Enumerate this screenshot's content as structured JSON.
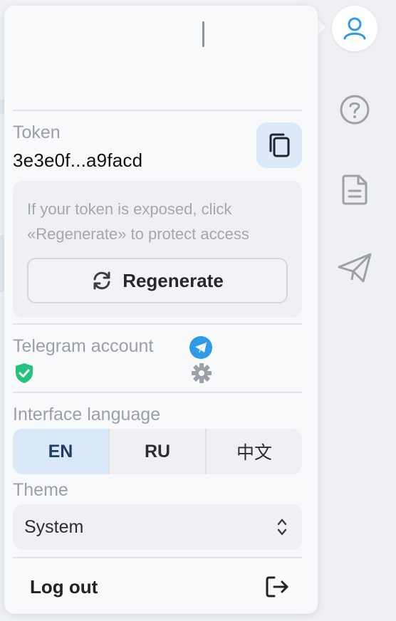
{
  "token": {
    "label": "Token",
    "value": "3e3e0f...a9facd",
    "warning": "If your token is exposed, click «Regenerate» to protect access",
    "regenerate_label": "Regenerate"
  },
  "telegram": {
    "label": "Telegram account"
  },
  "language": {
    "label": "Interface language",
    "options": [
      "EN",
      "RU",
      "中文"
    ],
    "selected": "EN"
  },
  "theme": {
    "label": "Theme",
    "value": "System"
  },
  "logout": {
    "label": "Log out"
  },
  "colors": {
    "accent": "#2f9ae8",
    "active_lang_bg": "#dbe8f8",
    "shield_green": "#22c37a",
    "rail_icon": "#9ca1a8"
  },
  "rail_icons": [
    "user-icon",
    "help-icon",
    "document-icon",
    "send-icon"
  ]
}
